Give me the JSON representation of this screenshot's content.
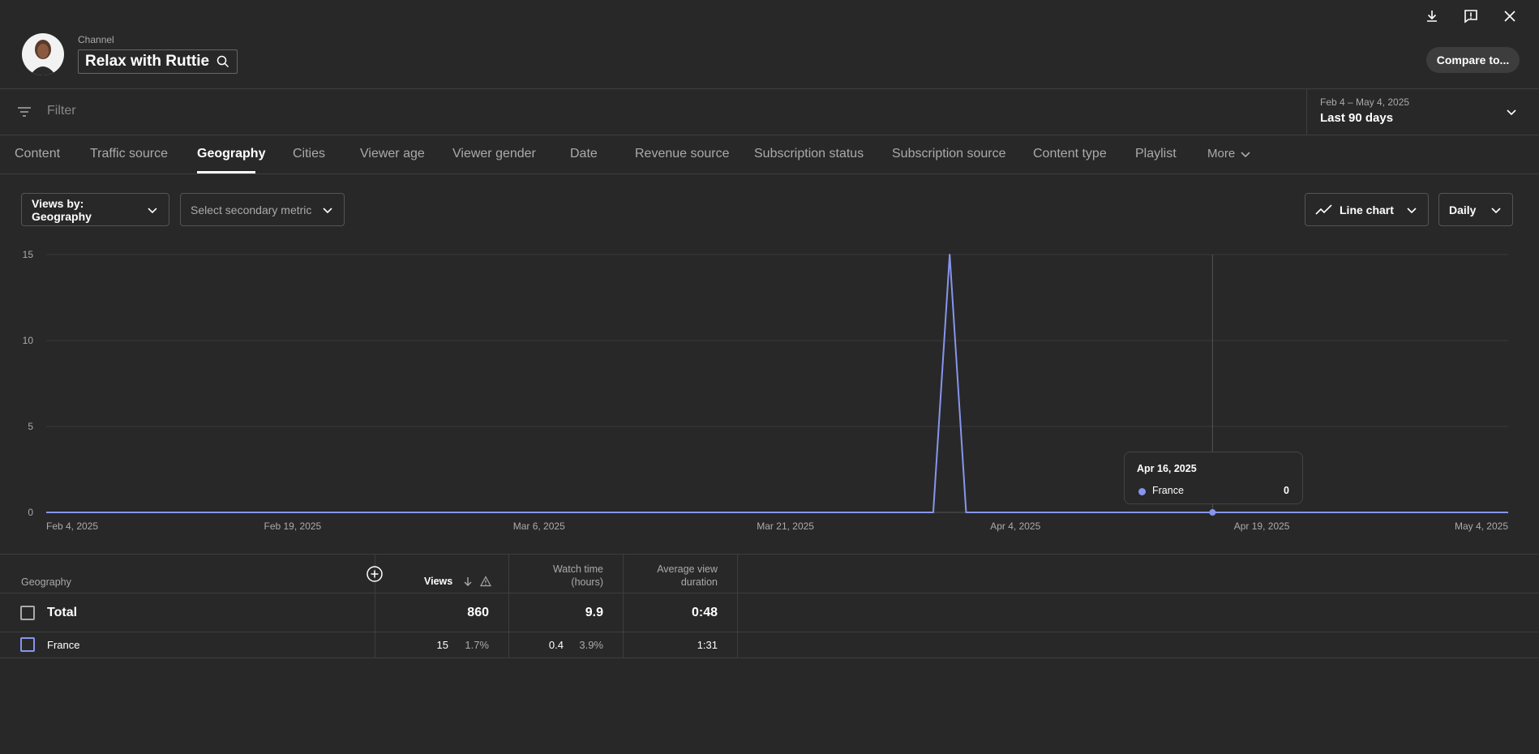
{
  "header": {
    "channel_label": "Channel",
    "channel_name": "Relax with Ruttie",
    "compare_label": "Compare to..."
  },
  "filter": {
    "placeholder": "Filter"
  },
  "date_range": {
    "range": "Feb 4 – May 4, 2025",
    "label": "Last 90 days"
  },
  "tabs": [
    {
      "label": "Content"
    },
    {
      "label": "Traffic source"
    },
    {
      "label": "Geography"
    },
    {
      "label": "Cities"
    },
    {
      "label": "Viewer age"
    },
    {
      "label": "Viewer gender"
    },
    {
      "label": "Date"
    },
    {
      "label": "Revenue source"
    },
    {
      "label": "Subscription status"
    },
    {
      "label": "Subscription source"
    },
    {
      "label": "Content type"
    },
    {
      "label": "Playlist"
    },
    {
      "label": "More"
    }
  ],
  "controls": {
    "primary_metric": "Views by: Geography",
    "secondary_metric": "Select secondary metric",
    "chart_type": "Line chart",
    "interval": "Daily"
  },
  "chart_data": {
    "type": "line",
    "y_ticks": [
      "15",
      "10",
      "5",
      "0"
    ],
    "ylim": [
      0,
      15
    ],
    "x_tick_labels": [
      "Feb 4, 2025",
      "Feb 19, 2025",
      "Mar 6, 2025",
      "Mar 21, 2025",
      "Apr 4, 2025",
      "Apr 19, 2025",
      "May 4, 2025"
    ],
    "series": [
      {
        "name": "France",
        "color": "#8795ee",
        "points": [
          [
            "Feb 4, 2025",
            0
          ],
          [
            "Mar 30, 2025",
            0
          ],
          [
            "Mar 31, 2025",
            15
          ],
          [
            "Apr 1, 2025",
            0
          ],
          [
            "May 4, 2025",
            0
          ]
        ]
      }
    ],
    "grid": true,
    "tooltip": {
      "date": "Apr 16, 2025",
      "series": "France",
      "value": "0"
    }
  },
  "table": {
    "headers": {
      "geography": "Geography",
      "views": "Views",
      "watch_time_line1": "Watch time",
      "watch_time_line2": "(hours)",
      "avg_line1": "Average view",
      "avg_line2": "duration"
    },
    "total": {
      "label": "Total",
      "views": "860",
      "watch_time": "9.9",
      "avg_duration": "0:48"
    },
    "rows": [
      {
        "label": "France",
        "views": "15",
        "views_pct": "1.7%",
        "watch_time": "0.4",
        "watch_pct": "3.9%",
        "avg_duration": "1:31"
      }
    ]
  },
  "colors": {
    "background": "#282828",
    "series": "#8795ee"
  }
}
